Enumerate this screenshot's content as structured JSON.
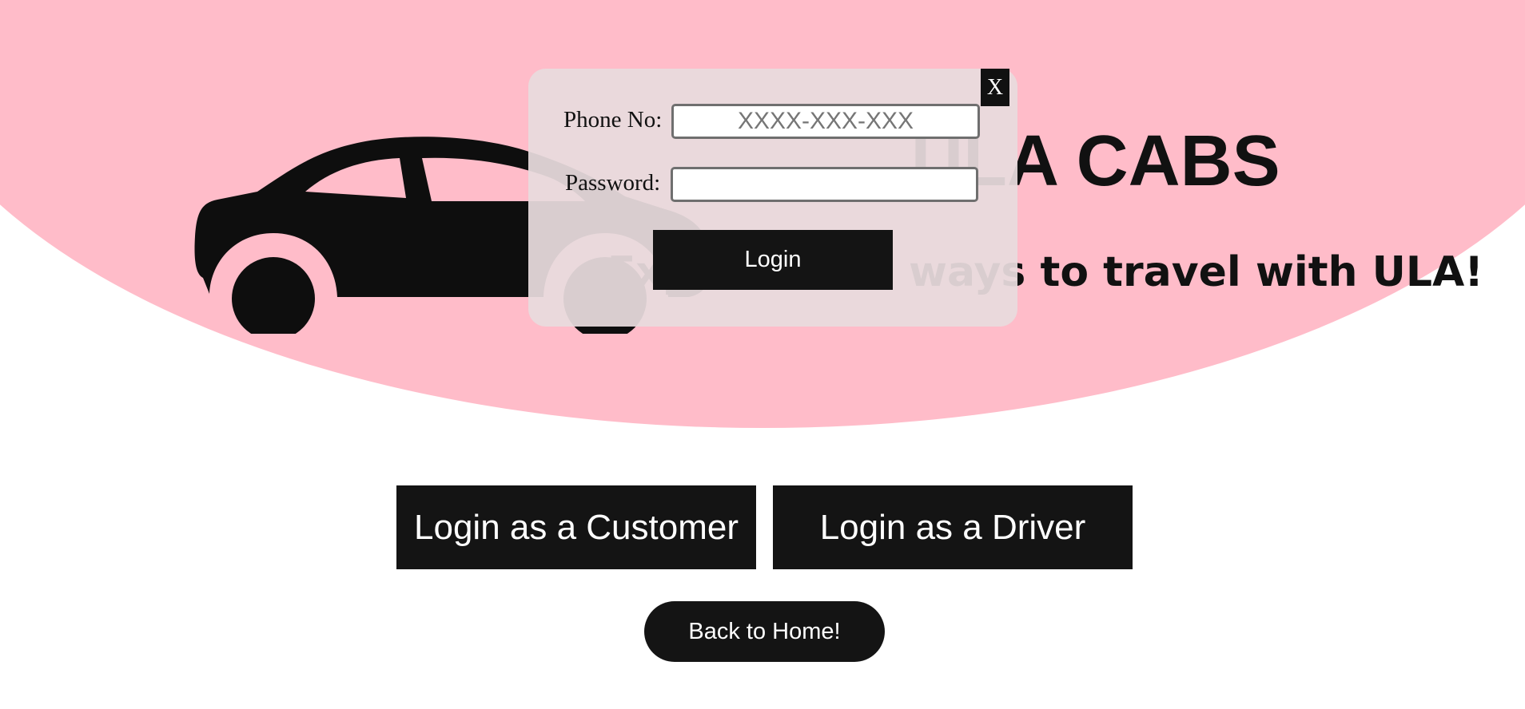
{
  "hero": {
    "title": "ULA CABS",
    "tagline": "Explore new ways to travel with ULA!",
    "background_color": "#ffbcc9",
    "car_icon": "car-icon"
  },
  "login_modal": {
    "close_label": "X",
    "phone_label": "Phone No:",
    "phone_placeholder": "XXXX-XXX-XXX",
    "phone_value": "",
    "password_label": "Password:",
    "password_value": "",
    "submit_label": "Login"
  },
  "actions": {
    "customer_login_label": "Login as a Customer",
    "driver_login_label": "Login as a Driver",
    "back_home_label": "Back to Home!"
  },
  "colors": {
    "button": "#141414",
    "button_text": "#ffffff"
  }
}
